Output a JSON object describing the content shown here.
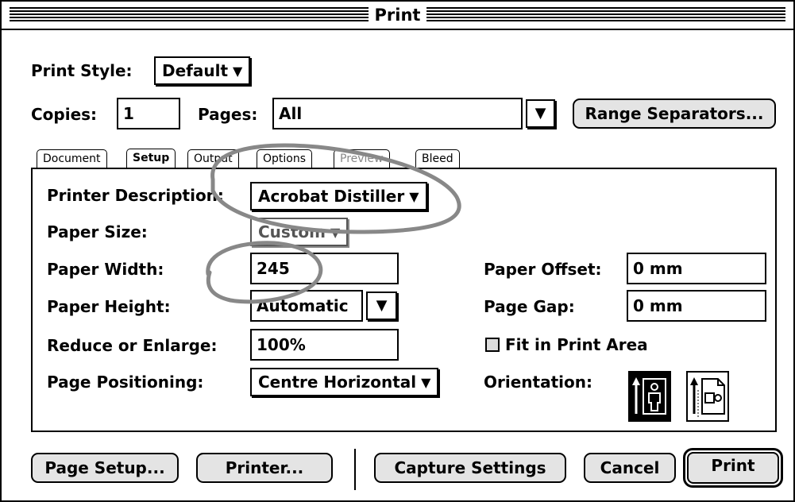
{
  "window": {
    "title": "Print"
  },
  "print_style": {
    "label": "Print Style:",
    "value": "Default"
  },
  "copies": {
    "label": "Copies:",
    "value": "1"
  },
  "pages": {
    "label": "Pages:",
    "value": "All"
  },
  "range_separators": {
    "label": "Range Separators..."
  },
  "tabs": [
    {
      "label": "Document",
      "active": false
    },
    {
      "label": "Setup",
      "active": true
    },
    {
      "label": "Output",
      "active": false
    },
    {
      "label": "Options",
      "active": false
    },
    {
      "label": "Preview",
      "active": false,
      "disabled": true
    },
    {
      "label": "Bleed",
      "active": false
    }
  ],
  "setup": {
    "printer_description": {
      "label": "Printer Description:",
      "value": "Acrobat Distiller"
    },
    "paper_size": {
      "label": "Paper Size:",
      "value": "Custom",
      "disabled": true
    },
    "paper_width": {
      "label": "Paper Width:",
      "value": "245"
    },
    "paper_height": {
      "label": "Paper Height:",
      "value": "Automatic"
    },
    "reduce_enlarge": {
      "label": "Reduce or Enlarge:",
      "value": "100%"
    },
    "page_positioning": {
      "label": "Page Positioning:",
      "value": "Centre Horizontal"
    },
    "paper_offset": {
      "label": "Paper Offset:",
      "value": "0  mm"
    },
    "page_gap": {
      "label": "Page Gap:",
      "value": "0  mm"
    },
    "fit_in_print_area": {
      "label": "Fit in Print Area",
      "checked": false
    },
    "orientation": {
      "label": "Orientation:",
      "selected": "portrait",
      "options": [
        "portrait",
        "landscape"
      ]
    }
  },
  "buttons": {
    "page_setup": "Page Setup...",
    "printer": "Printer...",
    "capture_settings": "Capture Settings",
    "cancel": "Cancel",
    "print": "Print"
  }
}
